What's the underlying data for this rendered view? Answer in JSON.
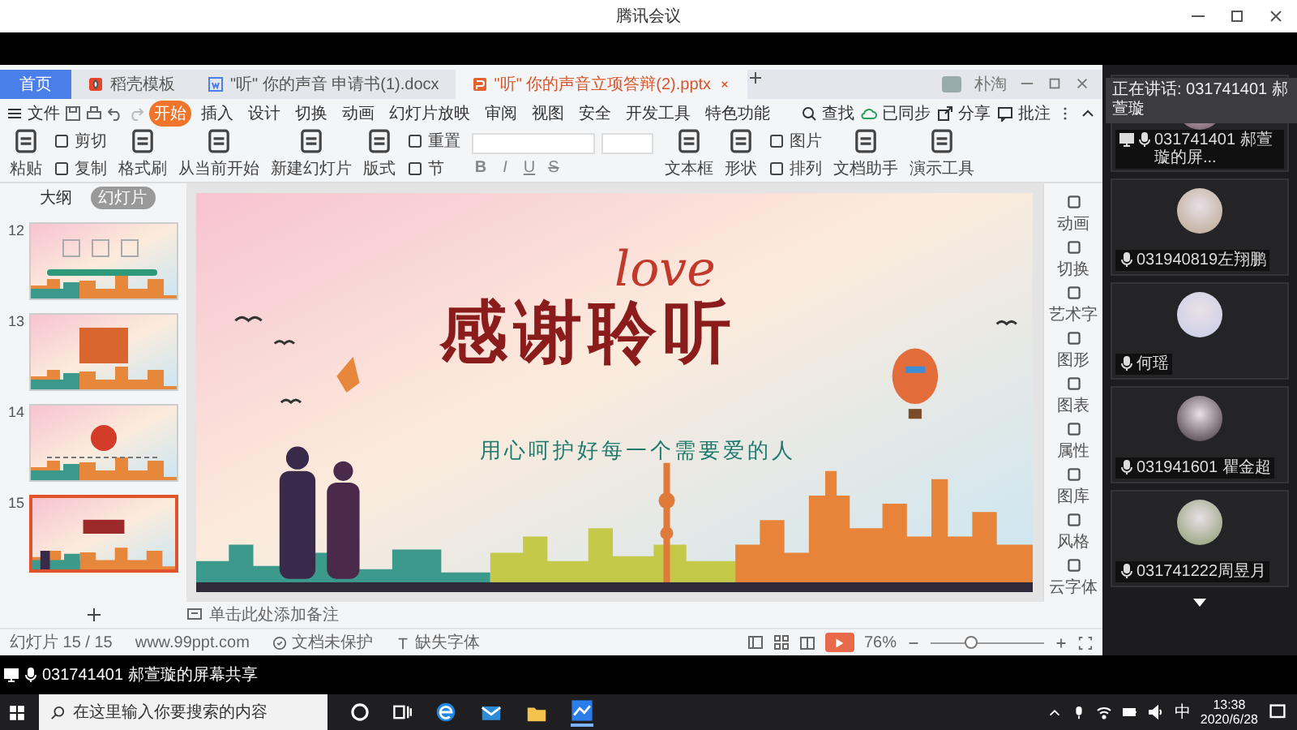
{
  "meeting": {
    "title": "腾讯会议",
    "share_label": "031741401 郝萱璇的屏幕共享"
  },
  "wps": {
    "tabs": [
      {
        "label": "首页",
        "kind": "home",
        "selected": false
      },
      {
        "label": "稻壳模板",
        "kind": "template",
        "selected": false
      },
      {
        "label": "\"听\" 你的声音 申请书(1).docx",
        "kind": "doc",
        "selected": false
      },
      {
        "label": "\"听\" 你的声音立项答辩(2).pptx",
        "kind": "ppt",
        "selected": true
      }
    ],
    "user": "朴淘",
    "file_menu": "文件",
    "menu": [
      {
        "label": "开始",
        "selected": true
      },
      {
        "label": "插入",
        "selected": false
      },
      {
        "label": "设计",
        "selected": false
      },
      {
        "label": "切换",
        "selected": false
      },
      {
        "label": "动画",
        "selected": false
      },
      {
        "label": "幻灯片放映",
        "selected": false
      },
      {
        "label": "审阅",
        "selected": false
      },
      {
        "label": "视图",
        "selected": false
      },
      {
        "label": "安全",
        "selected": false
      },
      {
        "label": "开发工具",
        "selected": false
      },
      {
        "label": "特色功能",
        "selected": false
      }
    ],
    "menu_right": [
      {
        "label": "查找",
        "kind": "search"
      },
      {
        "label": "已同步",
        "kind": "cloud"
      },
      {
        "label": "分享",
        "kind": "share"
      },
      {
        "label": "批注",
        "kind": "comment"
      }
    ],
    "ribbon_left": [
      [
        {
          "label": "粘贴"
        }
      ],
      [
        {
          "label": "剪切"
        },
        {
          "label": "复制"
        }
      ],
      [
        {
          "label": "格式刷"
        }
      ],
      [
        {
          "label": "从当前开始"
        }
      ],
      [
        {
          "label": "新建幻灯片"
        }
      ],
      [
        {
          "label": "版式"
        }
      ],
      [
        {
          "label": "重置"
        },
        {
          "label": "节"
        }
      ]
    ],
    "format_buttons": [
      {
        "label": "B",
        "kind": "bold"
      },
      {
        "label": "I",
        "kind": "italic"
      },
      {
        "label": "U",
        "kind": "underline"
      },
      {
        "label": "S",
        "kind": "strike"
      }
    ],
    "ribbon_right": [
      [
        {
          "label": "文本框"
        }
      ],
      [
        {
          "label": "形状"
        }
      ],
      [
        {
          "label": "图片"
        },
        {
          "label": "排列"
        }
      ],
      [
        {
          "label": "文档助手"
        }
      ],
      [
        {
          "label": "演示工具"
        }
      ]
    ],
    "panel_tabs": [
      {
        "label": "大纲",
        "selected": false
      },
      {
        "label": "幻灯片",
        "selected": true
      }
    ],
    "thumbnails": [
      {
        "number": "12",
        "selected": false
      },
      {
        "number": "13",
        "selected": false
      },
      {
        "number": "14",
        "selected": false
      },
      {
        "number": "15",
        "selected": true
      }
    ],
    "slide": {
      "title": "感谢聆听",
      "accent": "love",
      "subtitle": "用心呵护好每一个需要爱的人"
    },
    "side_tools": [
      "动画",
      "切换",
      "艺术字",
      "图形",
      "图表",
      "属性",
      "图库",
      "风格",
      "云字体"
    ],
    "notes_placeholder": "单击此处添加备注",
    "status": {
      "slide_count": "幻灯片 15 / 15",
      "template": "www.99ppt.com",
      "protection": "文档未保护",
      "fonts": "缺失字体",
      "zoom": "76%",
      "zoom_slider": {
        "level": 0.35
      }
    }
  },
  "participants": {
    "speaking": "正在讲话: 031741401 郝萱璇",
    "people": [
      {
        "name": "031741401 郝萱璇的屏...",
        "screen_sharing": true
      },
      {
        "name": "031940819左翔鹏",
        "screen_sharing": false
      },
      {
        "name": "何瑶",
        "screen_sharing": false
      },
      {
        "name": "031941601 瞿金超",
        "screen_sharing": false
      },
      {
        "name": "031741222周昱月",
        "screen_sharing": false
      }
    ]
  },
  "taskbar": {
    "search_placeholder": "在这里输入你要搜索的内容",
    "ime": "中",
    "time": "13:38",
    "date": "2020/6/28"
  }
}
